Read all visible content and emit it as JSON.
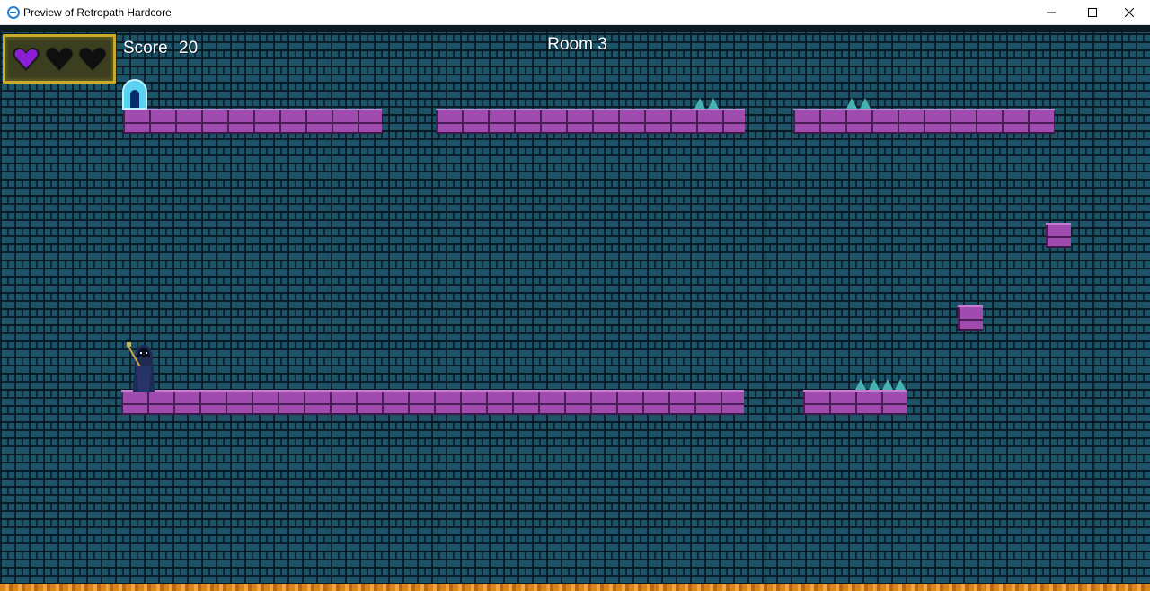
{
  "window": {
    "title": "Preview of Retropath Hardcore",
    "icon": "app-icon",
    "controls": [
      "minimize-icon",
      "maximize-icon",
      "close-icon"
    ]
  },
  "hud": {
    "score_label": "Score",
    "score_value": "20",
    "room_label": "Room 3",
    "hearts": [
      {
        "state": "full",
        "color": "#8a1fd6"
      },
      {
        "state": "empty",
        "color": "#1a1a1a"
      },
      {
        "state": "empty",
        "color": "#1a1a1a"
      }
    ]
  },
  "colors": {
    "background": "#1d5367",
    "platform": "#a04cae",
    "spike": "#47b3b0",
    "door": "#5ad2f2",
    "hud_frame": "#caa92b",
    "lava": "#d8861a"
  }
}
